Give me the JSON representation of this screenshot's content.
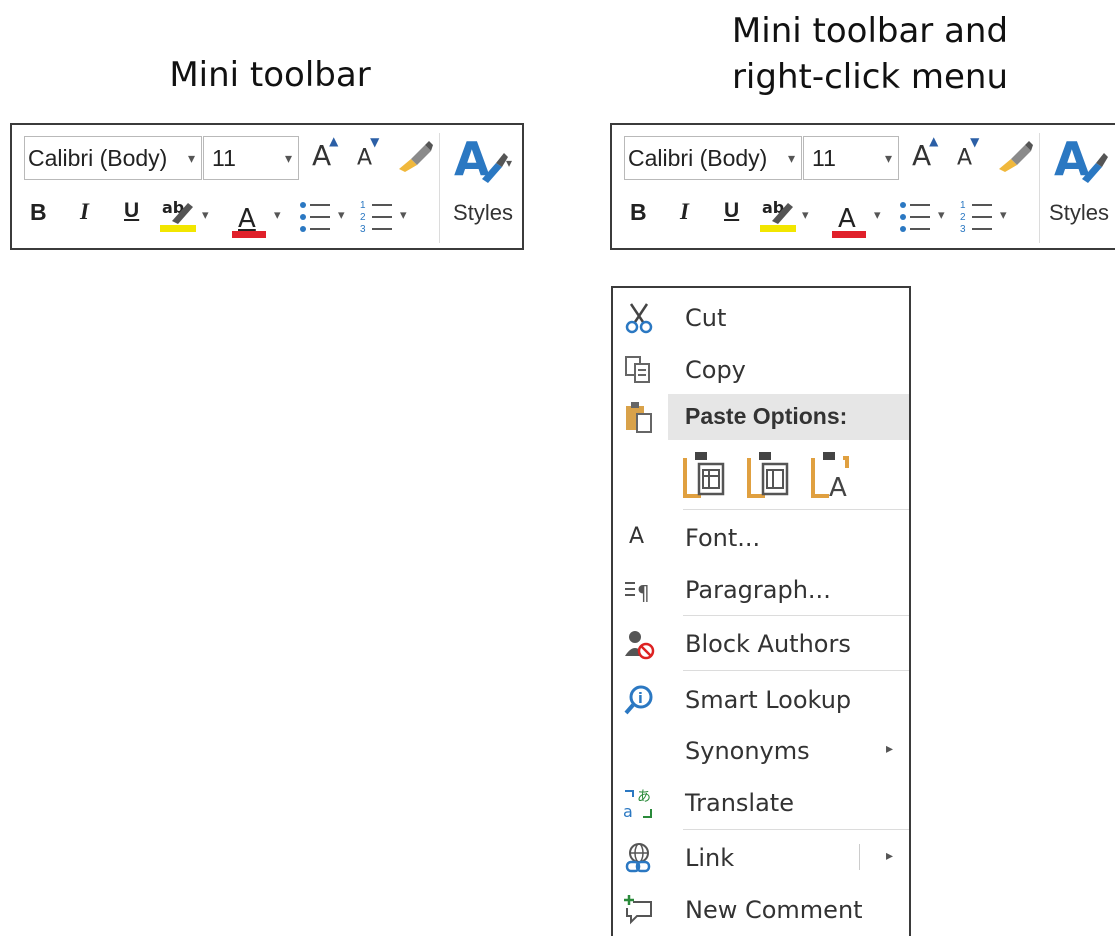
{
  "captions": {
    "left": "Mini toolbar",
    "right_line1": "Mini toolbar and",
    "right_line2": "right-click menu"
  },
  "toolbar": {
    "font_name": "Calibri (Body)",
    "font_size": "11",
    "grow_label": "A",
    "shrink_label": "A",
    "bold_label": "B",
    "italic_label": "I",
    "underline_label": "U",
    "font_color_label": "A",
    "styles_label": "Styles",
    "dropdown_glyph": "▾",
    "highlight_color": "#f2e600",
    "font_color": "#e0202a",
    "accent_color": "#2b78c2"
  },
  "menu": {
    "items": [
      {
        "label": "Cut",
        "icon": "scissors-icon"
      },
      {
        "label": "Copy",
        "icon": "copy-icon"
      },
      {
        "label": "Paste Options:",
        "icon": "paste-icon"
      },
      {
        "label": "Font...",
        "icon": "font-icon"
      },
      {
        "label": "Paragraph...",
        "icon": "paragraph-icon"
      },
      {
        "label": "Block Authors",
        "icon": "block-authors-icon"
      },
      {
        "label": "Smart Lookup",
        "icon": "smart-lookup-icon"
      },
      {
        "label": "Synonyms",
        "icon": ""
      },
      {
        "label": "Translate",
        "icon": "translate-icon"
      },
      {
        "label": "Link",
        "icon": "link-icon"
      },
      {
        "label": "New Comment",
        "icon": "new-comment-icon"
      }
    ],
    "font_icon_glyph": "A",
    "paste_text_glyph": "A",
    "submenu_glyph": "▸"
  }
}
